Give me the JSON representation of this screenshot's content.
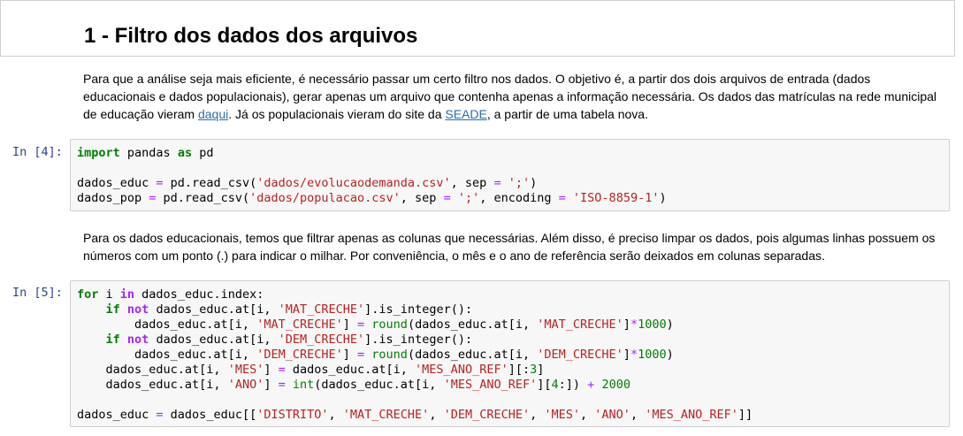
{
  "heading": {
    "title": "1 - Filtro dos dados dos arquivos"
  },
  "markdown1": {
    "text_a": "Para que a análise seja mais eficiente, é necessário passar um certo filtro nos dados. O objetivo é, a partir dos dois arquivos de entrada (dados educacionais e dados populacionais), gerar apenas um arquivo que contenha apenas a informação necessária. Os dados das matrículas na rede municipal de educação vieram ",
    "link1": "daqui",
    "text_b": ". Já os populacionais vieram do site da ",
    "link2": "SEADE",
    "text_c": ", a partir de uma tabela nova."
  },
  "cell1": {
    "prompt": "In [4]:",
    "lines": [
      [
        {
          "t": "kw",
          "v": "import"
        },
        {
          "t": "",
          "v": " pandas "
        },
        {
          "t": "kw",
          "v": "as"
        },
        {
          "t": "",
          "v": " pd"
        }
      ],
      [],
      [
        {
          "t": "",
          "v": "dados_educ "
        },
        {
          "t": "op",
          "v": "="
        },
        {
          "t": "",
          "v": " pd.read_csv("
        },
        {
          "t": "str",
          "v": "'dados/evolucaodemanda.csv'"
        },
        {
          "t": "",
          "v": ", sep "
        },
        {
          "t": "op",
          "v": "="
        },
        {
          "t": "",
          "v": " "
        },
        {
          "t": "str",
          "v": "';'"
        },
        {
          "t": "",
          "v": ")"
        }
      ],
      [
        {
          "t": "",
          "v": "dados_pop "
        },
        {
          "t": "op",
          "v": "="
        },
        {
          "t": "",
          "v": " pd.read_csv("
        },
        {
          "t": "str",
          "v": "'dados/populacao.csv'"
        },
        {
          "t": "",
          "v": ", sep "
        },
        {
          "t": "op",
          "v": "="
        },
        {
          "t": "",
          "v": " "
        },
        {
          "t": "str",
          "v": "';'"
        },
        {
          "t": "",
          "v": ", encoding "
        },
        {
          "t": "op",
          "v": "="
        },
        {
          "t": "",
          "v": " "
        },
        {
          "t": "str",
          "v": "'ISO-8859-1'"
        },
        {
          "t": "",
          "v": ")"
        }
      ]
    ]
  },
  "markdown2": {
    "text": "Para os dados educacionais, temos que filtrar apenas as colunas que necessárias. Além disso, é preciso limpar os dados, pois algumas linhas possuem os números com um ponto (.) para indicar o milhar. Por conveniência, o mês e o ano de referência serão deixados em colunas separadas."
  },
  "cell2": {
    "prompt": "In [5]:",
    "lines": [
      [
        {
          "t": "kw",
          "v": "for"
        },
        {
          "t": "",
          "v": " i "
        },
        {
          "t": "okw",
          "v": "in"
        },
        {
          "t": "",
          "v": " dados_educ.index:"
        }
      ],
      [
        {
          "t": "",
          "v": "    "
        },
        {
          "t": "kw",
          "v": "if"
        },
        {
          "t": "",
          "v": " "
        },
        {
          "t": "okw",
          "v": "not"
        },
        {
          "t": "",
          "v": " dados_educ.at[i, "
        },
        {
          "t": "str",
          "v": "'MAT_CRECHE'"
        },
        {
          "t": "",
          "v": "].is_integer():"
        }
      ],
      [
        {
          "t": "",
          "v": "        dados_educ.at[i, "
        },
        {
          "t": "str",
          "v": "'MAT_CRECHE'"
        },
        {
          "t": "",
          "v": "] "
        },
        {
          "t": "op",
          "v": "="
        },
        {
          "t": "",
          "v": " "
        },
        {
          "t": "bi",
          "v": "round"
        },
        {
          "t": "",
          "v": "(dados_educ.at[i, "
        },
        {
          "t": "str",
          "v": "'MAT_CRECHE'"
        },
        {
          "t": "",
          "v": "]"
        },
        {
          "t": "op",
          "v": "*"
        },
        {
          "t": "num",
          "v": "1000"
        },
        {
          "t": "",
          "v": ")"
        }
      ],
      [
        {
          "t": "",
          "v": "    "
        },
        {
          "t": "kw",
          "v": "if"
        },
        {
          "t": "",
          "v": " "
        },
        {
          "t": "okw",
          "v": "not"
        },
        {
          "t": "",
          "v": " dados_educ.at[i, "
        },
        {
          "t": "str",
          "v": "'DEM_CRECHE'"
        },
        {
          "t": "",
          "v": "].is_integer():"
        }
      ],
      [
        {
          "t": "",
          "v": "        dados_educ.at[i, "
        },
        {
          "t": "str",
          "v": "'DEM_CRECHE'"
        },
        {
          "t": "",
          "v": "] "
        },
        {
          "t": "op",
          "v": "="
        },
        {
          "t": "",
          "v": " "
        },
        {
          "t": "bi",
          "v": "round"
        },
        {
          "t": "",
          "v": "(dados_educ.at[i, "
        },
        {
          "t": "str",
          "v": "'DEM_CRECHE'"
        },
        {
          "t": "",
          "v": "]"
        },
        {
          "t": "op",
          "v": "*"
        },
        {
          "t": "num",
          "v": "1000"
        },
        {
          "t": "",
          "v": ")"
        }
      ],
      [
        {
          "t": "",
          "v": "    dados_educ.at[i, "
        },
        {
          "t": "str",
          "v": "'MES'"
        },
        {
          "t": "",
          "v": "] "
        },
        {
          "t": "op",
          "v": "="
        },
        {
          "t": "",
          "v": " dados_educ.at[i, "
        },
        {
          "t": "str",
          "v": "'MES_ANO_REF'"
        },
        {
          "t": "",
          "v": "][:"
        },
        {
          "t": "num",
          "v": "3"
        },
        {
          "t": "",
          "v": "]"
        }
      ],
      [
        {
          "t": "",
          "v": "    dados_educ.at[i, "
        },
        {
          "t": "str",
          "v": "'ANO'"
        },
        {
          "t": "",
          "v": "] "
        },
        {
          "t": "op",
          "v": "="
        },
        {
          "t": "",
          "v": " "
        },
        {
          "t": "bi",
          "v": "int"
        },
        {
          "t": "",
          "v": "(dados_educ.at[i, "
        },
        {
          "t": "str",
          "v": "'MES_ANO_REF'"
        },
        {
          "t": "",
          "v": "]["
        },
        {
          "t": "num",
          "v": "4"
        },
        {
          "t": "",
          "v": ":]) "
        },
        {
          "t": "op",
          "v": "+"
        },
        {
          "t": "",
          "v": " "
        },
        {
          "t": "num",
          "v": "2000"
        }
      ],
      [],
      [
        {
          "t": "",
          "v": "dados_educ "
        },
        {
          "t": "op",
          "v": "="
        },
        {
          "t": "",
          "v": " dados_educ[["
        },
        {
          "t": "str",
          "v": "'DISTRITO'"
        },
        {
          "t": "",
          "v": ", "
        },
        {
          "t": "str",
          "v": "'MAT_CRECHE'"
        },
        {
          "t": "",
          "v": ", "
        },
        {
          "t": "str",
          "v": "'DEM_CRECHE'"
        },
        {
          "t": "",
          "v": ", "
        },
        {
          "t": "str",
          "v": "'MES'"
        },
        {
          "t": "",
          "v": ", "
        },
        {
          "t": "str",
          "v": "'ANO'"
        },
        {
          "t": "",
          "v": ", "
        },
        {
          "t": "str",
          "v": "'MES_ANO_REF'"
        },
        {
          "t": "",
          "v": "]]"
        }
      ]
    ]
  }
}
